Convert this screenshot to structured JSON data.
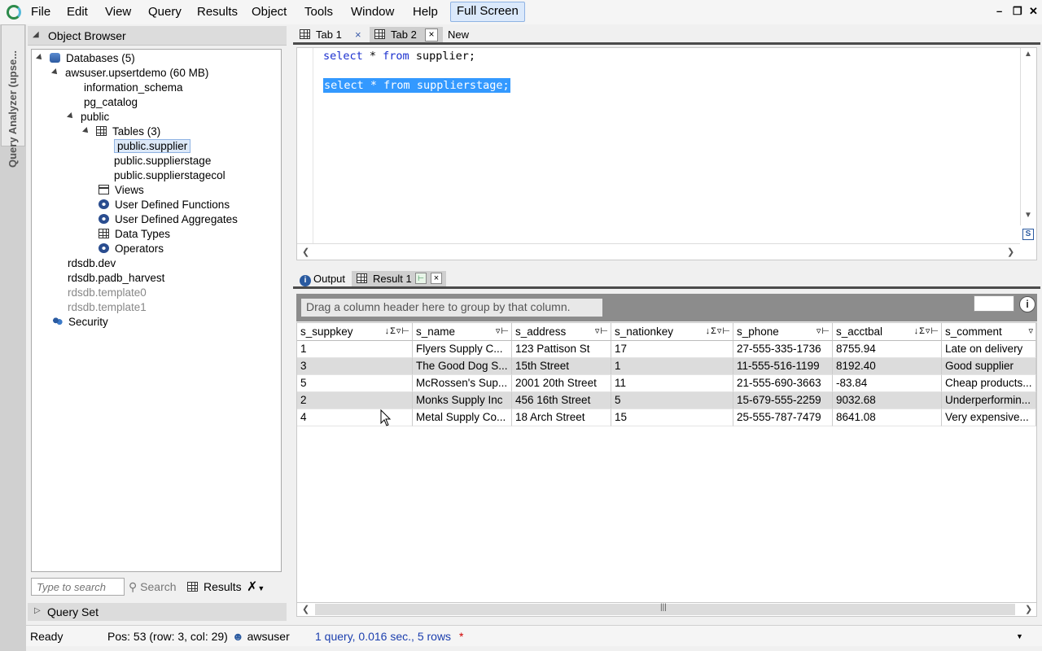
{
  "menu": {
    "items": [
      "File",
      "Edit",
      "View",
      "Query",
      "Results",
      "Object",
      "Tools",
      "Window",
      "Help"
    ],
    "fullscreen_label": "Full Screen"
  },
  "side_strip": {
    "label": "Query Analyzer (upse..."
  },
  "object_browser": {
    "title": "Object Browser",
    "tree": {
      "databases": "Databases (5)",
      "db_active": "awsuser.upsertdemo (60 MB)",
      "schema_info": "information_schema",
      "schema_pg": "pg_catalog",
      "schema_public": "public",
      "tables": "Tables (3)",
      "table_1": "public.supplier",
      "table_2": "public.supplierstage",
      "table_3": "public.supplierstagecol",
      "views": "Views",
      "udf": "User Defined Functions",
      "uda": "User Defined Aggregates",
      "data_types": "Data Types",
      "operators": "Operators",
      "db_dev": "rdsdb.dev",
      "db_padb": "rdsdb.padb_harvest",
      "db_template0": "rdsdb.template0",
      "db_template1": "rdsdb.template1",
      "security": "Security"
    },
    "search_placeholder": "Type to search",
    "search_label": "Search",
    "results_label": "Results",
    "query_set_label": "Query Set"
  },
  "editor": {
    "tabs": [
      "Tab 1",
      "Tab 2",
      "New"
    ],
    "line1": {
      "kw1": "select",
      "mid1": " * ",
      "kw2": "from",
      "rest": " supplier;"
    },
    "line3": {
      "kw1": "select",
      "mid1": " * ",
      "kw2": "from",
      "rest": " supplierstage;"
    }
  },
  "results": {
    "tabs": [
      "Output",
      "Result 1"
    ],
    "groupby_hint": "Drag a column header here to group by that column.",
    "columns": [
      "s_suppkey",
      "s_name",
      "s_address",
      "s_nationkey",
      "s_phone",
      "s_acctbal",
      "s_comment"
    ],
    "rows": [
      [
        "1",
        "Flyers Supply C...",
        "123 Pattison St",
        "17",
        "27-555-335-1736",
        "8755.94",
        "Late on delivery"
      ],
      [
        "3",
        "The Good Dog S...",
        "15th Street",
        "1",
        "11-555-516-1199",
        "8192.40",
        "Good supplier"
      ],
      [
        "5",
        "McRossen's Sup...",
        "2001 20th Street",
        "11",
        "21-555-690-3663",
        "-83.84",
        "Cheap products..."
      ],
      [
        "2",
        "Monks Supply Inc",
        "456 16th Street",
        "5",
        "15-679-555-2259",
        "9032.68",
        " Underperformin..."
      ],
      [
        "4",
        "Metal Supply Co...",
        "18 Arch Street",
        "15",
        "25-555-787-7479",
        "8641.08",
        "Very expensive..."
      ]
    ]
  },
  "status": {
    "ready": "Ready",
    "position": "Pos: 53 (row: 3, col: 29)",
    "user": "awsuser",
    "summary": "1 query, 0.016 sec., 5 rows",
    "modified_marker": "*"
  },
  "colors": {
    "accent": "#2a5aa0",
    "selection": "#3399ff",
    "keyword": "#1a2fcf",
    "status_link": "#1c3fae",
    "modified": "#d00000"
  }
}
